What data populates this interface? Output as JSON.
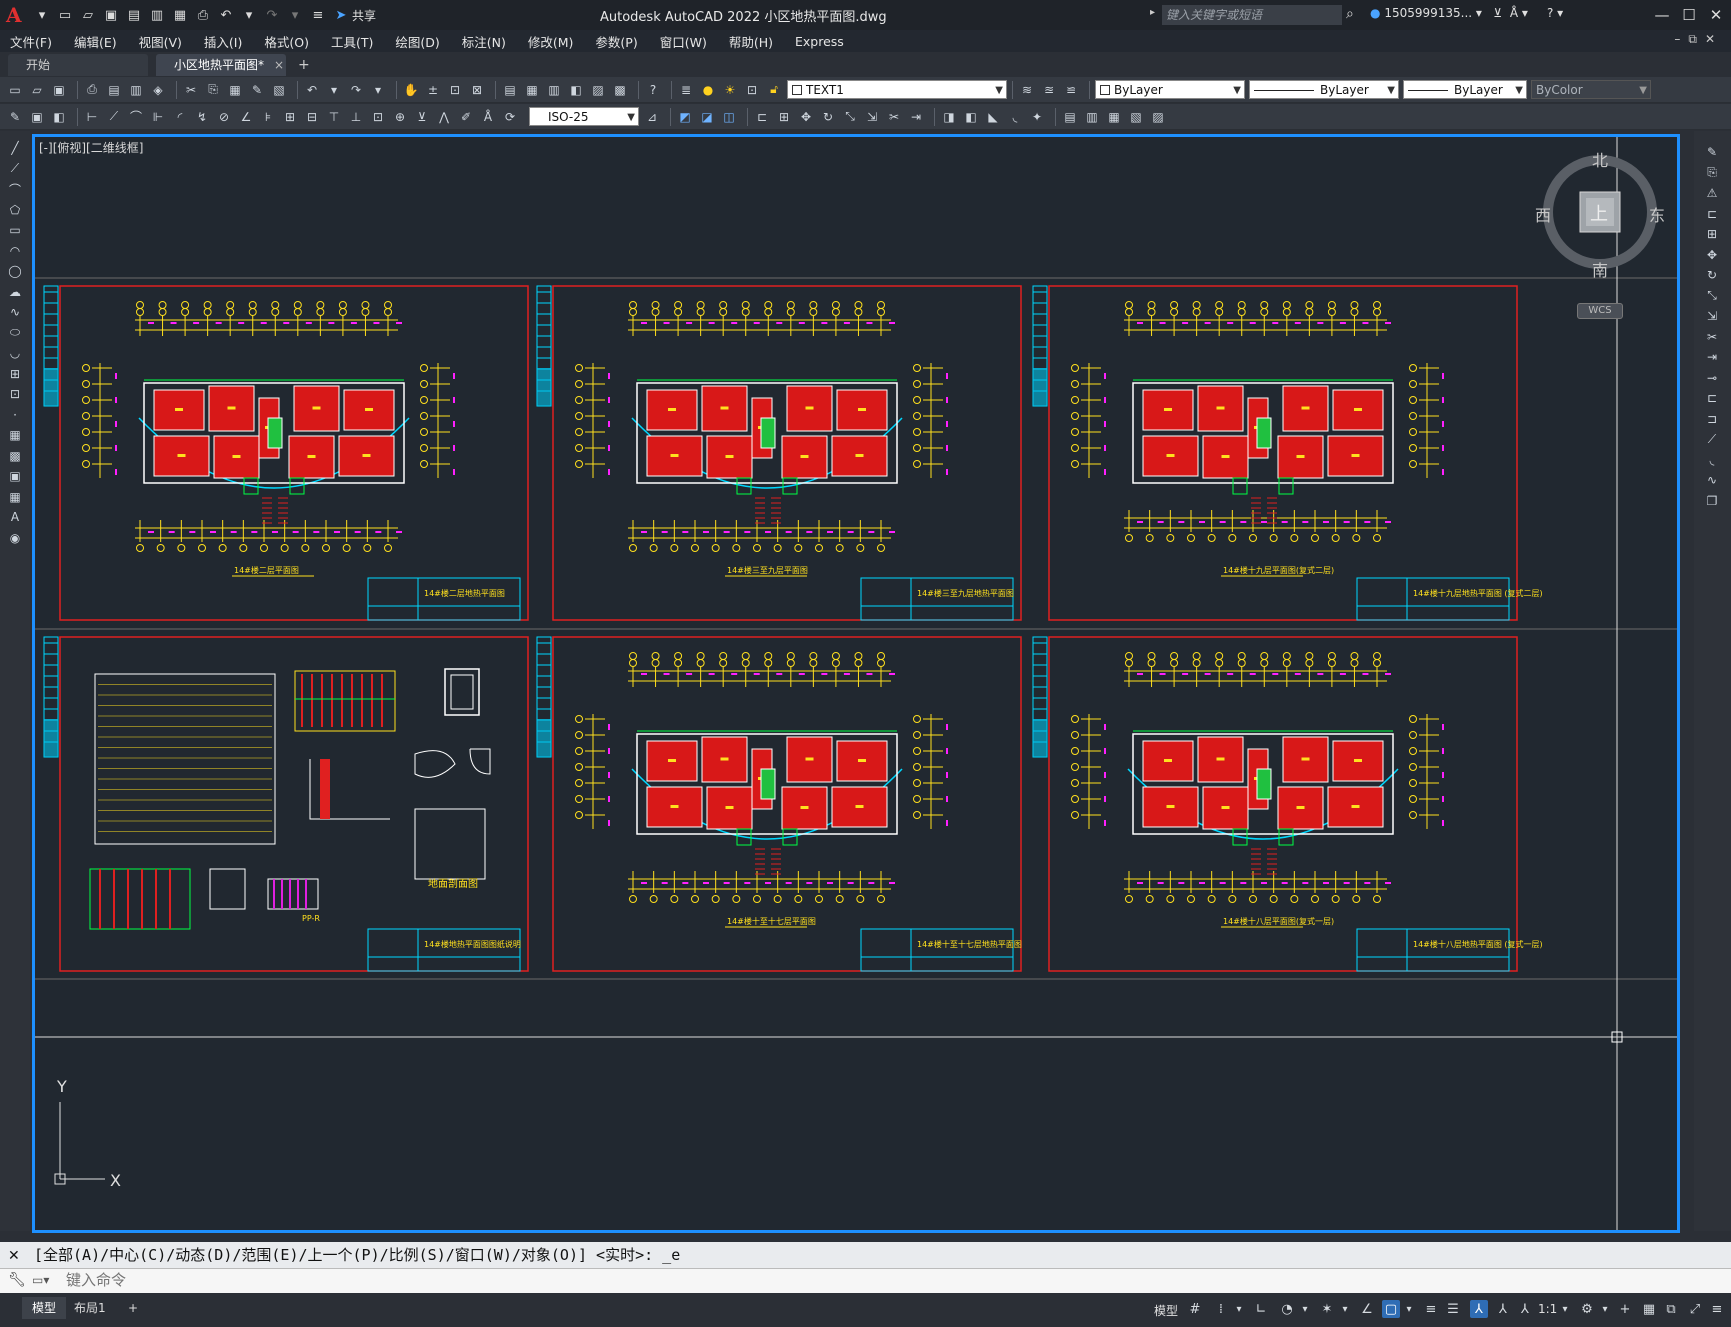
{
  "app": {
    "title": "Autodesk AutoCAD 2022    小区地热平面图.dwg",
    "logo": "A",
    "share_label": "共享",
    "search_placeholder": "键入关键字或短语",
    "user": "1505999135...",
    "colors": {
      "accent": "#1e90ff",
      "canvas": "#212830",
      "frame_red": "#e02020"
    }
  },
  "menu": {
    "items": [
      "文件(F)",
      "编辑(E)",
      "视图(V)",
      "插入(I)",
      "格式(O)",
      "工具(T)",
      "绘图(D)",
      "标注(N)",
      "修改(M)",
      "参数(P)",
      "窗口(W)",
      "帮助(H)",
      "Express"
    ]
  },
  "tabs": {
    "start": "开始",
    "active": "小区地热平面图*",
    "close": "×",
    "add": "+"
  },
  "toolbar": {
    "text_style": "TEXT1",
    "layer": "ByLayer",
    "linetype": "ByLayer",
    "lineweight": "ByLayer",
    "color": "ByColor",
    "dim_style": "ISO-25"
  },
  "viewport": {
    "label": "[-][俯视][二维线框]",
    "compass": {
      "north": "北",
      "south": "南",
      "east": "东",
      "west": "西",
      "top": "上"
    },
    "wcs": "WCS",
    "ucs_y": "Y",
    "ucs_x": "X"
  },
  "sheets": [
    {
      "title": "14#楼二层平面图",
      "stamp": "14#楼二层地热平面图"
    },
    {
      "title": "14#楼三至九层平面图",
      "stamp": "14#楼三至九层地热平面图"
    },
    {
      "title": "14#楼十九层平面图(复式二层)",
      "stamp": "14#楼十九层地热平面图 (复式二层)"
    },
    {
      "title": "",
      "stamp": "14#楼地热平面图图纸说明",
      "section_label": "地面剖面图",
      "pp_label": "PP-R"
    },
    {
      "title": "14#楼十至十七层平面图",
      "stamp": "14#楼十至十七层地热平面图"
    },
    {
      "title": "14#楼十八层平面图(复式一层)",
      "stamp": "14#楼十八层地热平面图 (复式一层)"
    }
  ],
  "command": {
    "history": "[全部(A)/中心(C)/动态(D)/范围(E)/上一个(P)/比例(S)/窗口(W)/对象(O)] <实时>: _e",
    "placeholder": "键入命令"
  },
  "status": {
    "model_tab": "模型",
    "layout_tab": "布局1",
    "add_tab": "+",
    "model_space": "模型",
    "scale": "1:1"
  }
}
